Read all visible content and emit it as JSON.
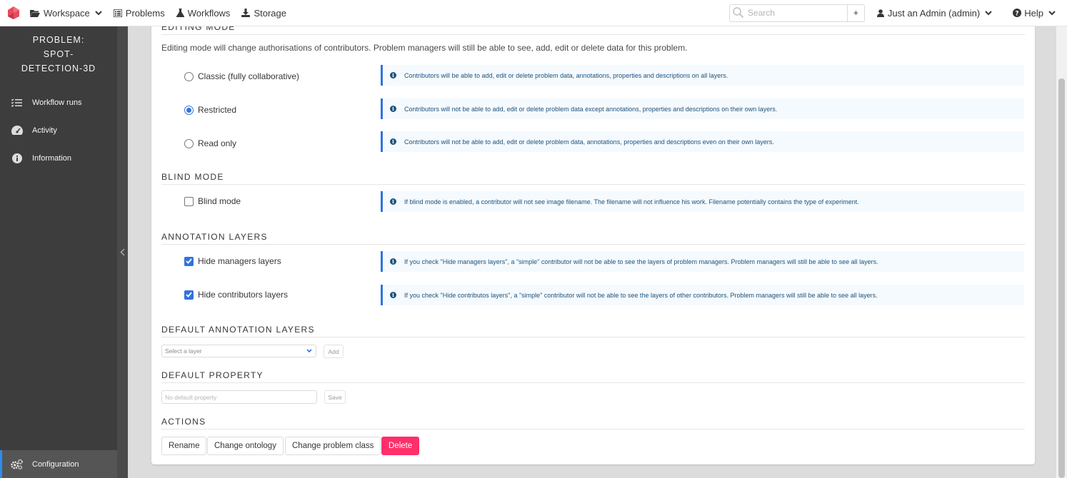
{
  "navbar": {
    "items": [
      {
        "label": "Workspace",
        "icon": "folder-open-icon",
        "dropdown": true
      },
      {
        "label": "Problems",
        "icon": "list-icon"
      },
      {
        "label": "Workflows",
        "icon": "flask-icon"
      },
      {
        "label": "Storage",
        "icon": "download-icon"
      }
    ],
    "search_placeholder": "Search",
    "plus_label": "+",
    "user_label": "Just an Admin (admin)",
    "help_label": "Help"
  },
  "sidebar": {
    "title": "PROBLEM: SPOT-DETECTION-3D",
    "items": [
      {
        "label": "Workflow runs",
        "icon": "tasks-icon"
      },
      {
        "label": "Activity",
        "icon": "tachometer-icon"
      },
      {
        "label": "Information",
        "icon": "info-circle-icon"
      }
    ],
    "active_item": {
      "label": "Configuration",
      "icon": "cogs-icon"
    }
  },
  "editing_mode": {
    "heading": "EDITING MODE",
    "description": "Editing mode will change authorisations of contributors. Problem managers will still be able to see, add, edit or delete data for this problem.",
    "options": [
      {
        "label": "Classic (fully collaborative)",
        "selected": false,
        "info": "Contributors will be able to add, edit or delete problem data, annotations, properties and descriptions on all layers."
      },
      {
        "label": "Restricted",
        "selected": true,
        "info": "Contributors will not be able to add, edit or delete problem data except annotations, properties and descriptions on their own layers."
      },
      {
        "label": "Read only",
        "selected": false,
        "info": "Contributors will not be able to add, edit or delete problem data, annotations, properties and descriptions even on their own layers."
      }
    ]
  },
  "blind_mode": {
    "heading": "BLIND MODE",
    "label": "Blind mode",
    "checked": false,
    "info": "If blind mode is enabled, a contributor will not see image filename. The filename will not influence his work. Filename potentially contains the type of experiment."
  },
  "annotation_layers": {
    "heading": "ANNOTATION LAYERS",
    "options": [
      {
        "label": "Hide managers layers",
        "checked": true,
        "info": "If you check \"Hide managers layers\", a \"simple\" contributor will not be able to see the layers of problem managers. Problem managers will still be able to see all layers."
      },
      {
        "label": "Hide contributors layers",
        "checked": true,
        "info": "If you check \"Hide contributos layers\", a \"simple\" contributor will not be able to see the layers of other contributors. Problem managers will still be able to see all layers."
      }
    ]
  },
  "default_annotation_layers": {
    "heading": "DEFAULT ANNOTATION LAYERS",
    "select_placeholder": "Select a layer",
    "add_label": "Add"
  },
  "default_property": {
    "heading": "DEFAULT PROPERTY",
    "input_placeholder": "No default property",
    "save_label": "Save"
  },
  "actions": {
    "heading": "ACTIONS",
    "rename_label": "Rename",
    "change_ontology_label": "Change ontology",
    "change_problem_class_label": "Change problem class",
    "delete_label": "Delete"
  },
  "colors": {
    "accent": "#3273dc",
    "danger": "#ff2f6a",
    "sidebar_bg": "#3d3d3d",
    "info_text": "#20537a"
  }
}
